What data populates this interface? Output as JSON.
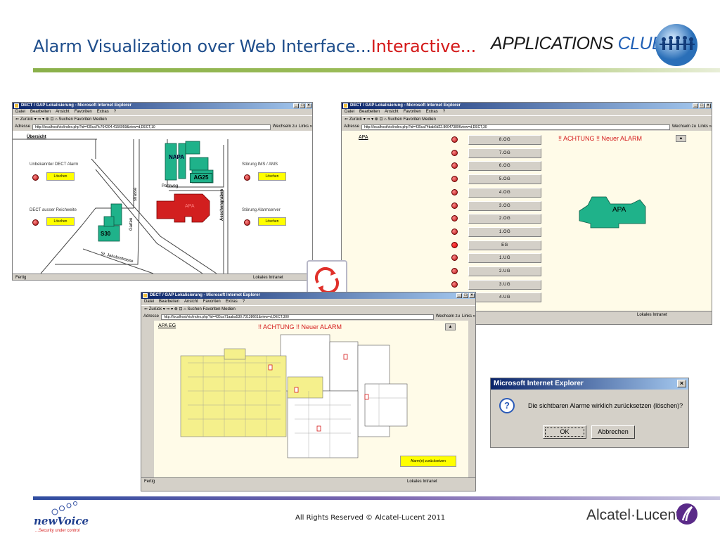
{
  "slide": {
    "title_main": "Alarm Visualization over Web Interface...",
    "title_accent": "Interactive...",
    "club_a": "APPLICATIONS",
    "club_b": "CLUB",
    "footer": "All Rights Reserved © Alcatel-Lucent 2011",
    "brand": "Alcatel·Lucent",
    "newvoice": "newVoice",
    "newvoice_tag": "...Security under control",
    "accent_color": "#d41a1a",
    "title_color": "#1f4e8c"
  },
  "win1": {
    "title": "DECT / GAP Lokalisierung - Microsoft Internet Explorer",
    "menu": [
      "Datei",
      "Bearbeiten",
      "Ansicht",
      "Favoriten",
      "Extras",
      "?"
    ],
    "toolbar": "⇐ Zurück ▾ ⇒ ▾ ⊗ ⊡ ⌂  Suchen  Favoriten  Medien",
    "address_label": "Adresse",
    "address": "http://localhost/vis/index.php?id=435ca7fc764204.4156059&view=d,DECT,10",
    "go": "Wechseln zu",
    "links": "Links »",
    "status_left": "Fertig",
    "status_right": "Lokales Intranet",
    "overview": "Übersicht",
    "alarm1": "Unbekannter DECT Alarm",
    "alarm2": "DECT ausser Reichweite",
    "alarm3": "Störung IMS / AMS",
    "alarm4": "Störung Alarmserver",
    "btn": "Löschen",
    "napa": "NAPA",
    "ag25": "AG25",
    "apa": "APA",
    "s30": "S30",
    "parkweg": "Parkweg",
    "garten": "Garten",
    "strasse": "strasse",
    "aeschengraben": "Aeschengraben",
    "jakob": "St. Jakobsstrasse"
  },
  "win2": {
    "title": "DECT / GAP Lokalisierung - Microsoft Internet Explorer",
    "menu": [
      "Datei",
      "Bearbeiten",
      "Ansicht",
      "Favoriten",
      "Extras",
      "?"
    ],
    "toolbar": "⇐ Zurück ▾ ⇒ ▾ ⊗ ⊡ ⌂  Suchen  Favoriten  Medien",
    "address_label": "Adresse",
    "address": "http://localhost/vis/index.php?id=435ca74bab6d22.860473896view=d,DECT,30",
    "go": "Wechseln zu",
    "links": "Links »",
    "status_right": "Lokales Intranet",
    "tab": "APA",
    "alarm": "!! ACHTUNG !! Neuer ALARM",
    "building": "APA",
    "floors": [
      "8.OG",
      "7.OG",
      "6.OG",
      "5.OG",
      "4.OG",
      "3.OG",
      "2.OG",
      "1.OG",
      "EG",
      "1.UG",
      "2.UG",
      "3.UG",
      "4.UG"
    ]
  },
  "win3": {
    "title": "DECT / GAP Lokalisierung - Microsoft Internet Explorer",
    "menu": [
      "Datei",
      "Bearbeiten",
      "Ansicht",
      "Favoriten",
      "Extras",
      "?"
    ],
    "toolbar": "⇐ Zurück ▾ ⇒ ▾ ⊗ ⊡ ⌂  Suchen  Favoriten  Medien",
    "address_label": "Adresse",
    "address": "http://localhost/vis/index.php?id=435ca71aaba530.73138661&view=d,DECT,300",
    "go": "Wechseln zu",
    "links": "Links »",
    "status_left": "Fertig",
    "status_right": "Lokales Intranet",
    "tab": "APA EG",
    "alarm": "!! ACHTUNG !! Neuer ALARM",
    "reset": "Alarm(e) zurücksetzen"
  },
  "dialog": {
    "title": "Microsoft Internet Explorer",
    "message": "Die sichtbaren Alarme wirklich zurücksetzen (löschen)?",
    "ok": "OK",
    "cancel": "Abbrechen"
  }
}
